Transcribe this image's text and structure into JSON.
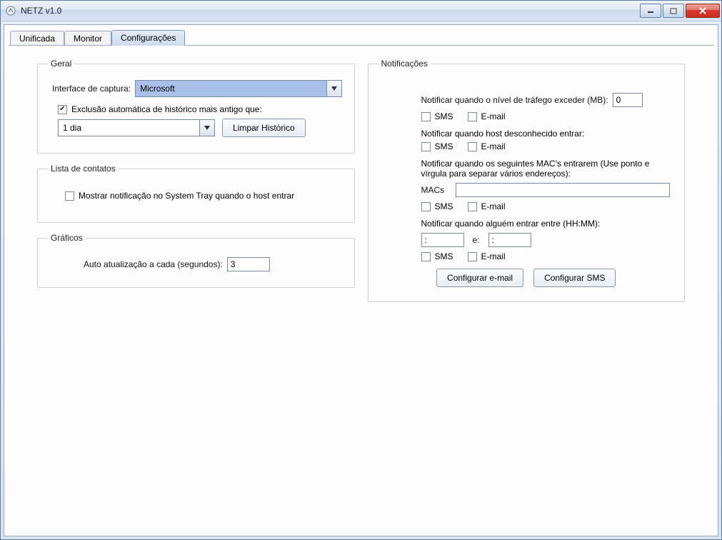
{
  "window": {
    "title": "NETZ v1.0"
  },
  "tabs": [
    {
      "label": "Unificada"
    },
    {
      "label": "Monitor"
    },
    {
      "label": "Configurações"
    }
  ],
  "active_tab": 2,
  "geral": {
    "legend": "Geral",
    "interface_label": "Interface de captura:",
    "interface_value": "Microsoft",
    "auto_delete_label": "Exclusão automática de histórico mais antigo que:",
    "auto_delete_checked": true,
    "retention_value": "1 dia",
    "clear_history_btn": "Limpar Histórico"
  },
  "contatos": {
    "legend": "Lista de contatos",
    "show_tray_label": "Mostrar notificação no System Tray quando o host entrar",
    "show_tray_checked": false
  },
  "graficos": {
    "legend": "Gráficos",
    "auto_update_label": "Auto atualização a cada (segundos):",
    "auto_update_value": "3"
  },
  "notificacoes": {
    "legend": "Notificações",
    "traffic_label": "Notificar quando o nível de tráfego exceder (MB):",
    "traffic_value": "0",
    "sms_label": "SMS",
    "email_label": "E-mail",
    "traffic_sms": false,
    "traffic_email": false,
    "unknown_host_label": "Notificar quando host desconhecido entrar:",
    "unknown_sms": false,
    "unknown_email": false,
    "macs_intro": "Notificar quando os seguintes MAC's entrarem (Use ponto e vírgula para separar vários endereços):",
    "macs_label": "MACs",
    "macs_value": "",
    "macs_sms": false,
    "macs_email": false,
    "time_label": "Notificar quando alguém entrar entre (HH:MM):",
    "time_from": ":",
    "time_and": "e:",
    "time_to": ":",
    "time_sms": false,
    "time_email": false,
    "config_email_btn": "Configurar e-mail",
    "config_sms_btn": "Configurar SMS"
  }
}
